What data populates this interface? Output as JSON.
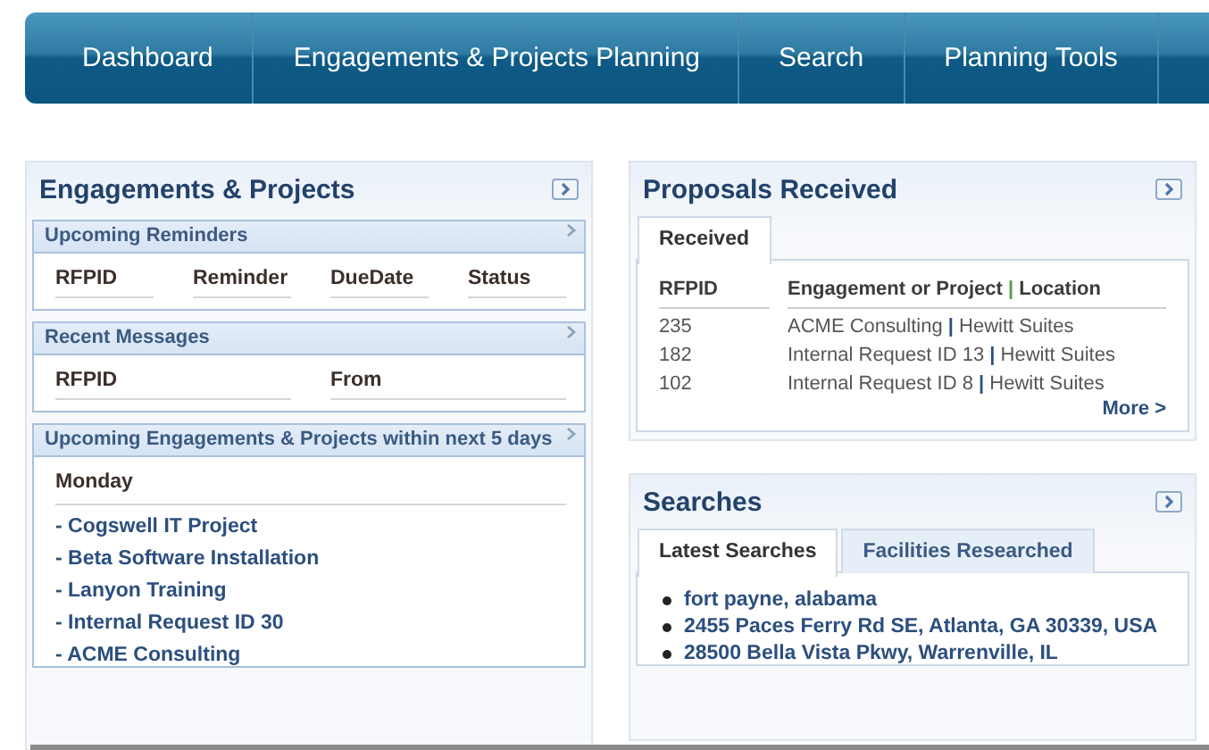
{
  "nav": {
    "items": [
      {
        "label": "Dashboard"
      },
      {
        "label": "Engagements & Projects Planning"
      },
      {
        "label": "Search"
      },
      {
        "label": "Planning Tools"
      }
    ]
  },
  "engagements_panel": {
    "title": "Engagements & Projects",
    "sections": [
      {
        "kind": "table",
        "title": "Upcoming Reminders",
        "columns": [
          "RFPID",
          "Reminder",
          "DueDate",
          "Status"
        ]
      },
      {
        "kind": "table",
        "title": "Recent Messages",
        "columns": [
          "RFPID",
          "From"
        ]
      },
      {
        "kind": "list",
        "title": "Upcoming Engagements & Projects within next 5 days",
        "day": "Monday",
        "items": [
          "- Cogswell IT Project",
          "- Beta Software Installation",
          "- Lanyon Training",
          "- Internal Request ID 30",
          "- ACME Consulting"
        ]
      }
    ]
  },
  "proposals_panel": {
    "title": "Proposals Received",
    "tabs": [
      {
        "label": "Received",
        "selected": true
      }
    ],
    "separator": "|",
    "columns": [
      "RFPID",
      "Engagement or Project",
      "Location"
    ],
    "rows": [
      {
        "rfpid": "235",
        "project": "ACME Consulting",
        "location": "Hewitt Suites"
      },
      {
        "rfpid": "182",
        "project": "Internal Request ID 13",
        "location": "Hewitt Suites"
      },
      {
        "rfpid": "102",
        "project": "Internal Request ID 8",
        "location": "Hewitt Suites"
      }
    ],
    "more": "More >"
  },
  "searches_panel": {
    "title": "Searches",
    "tabs": [
      {
        "label": "Latest Searches",
        "selected": true
      },
      {
        "label": "Facilities Researched",
        "selected": false
      }
    ],
    "items": [
      "fort payne, alabama",
      "2455 Paces Ferry Rd SE, Atlanta, GA 30339, USA",
      "28500 Bella Vista Pkwy, Warrenville, IL"
    ]
  }
}
